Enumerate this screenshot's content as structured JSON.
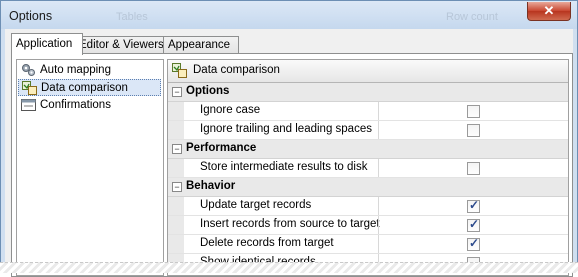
{
  "window": {
    "title": "Options",
    "close_glyph": "✕",
    "ghost_left": "Tables",
    "ghost_right": "Row count"
  },
  "tabs": [
    {
      "label": "Application",
      "active": true
    },
    {
      "label": "Editor & Viewers",
      "active": false
    },
    {
      "label": "Appearance",
      "active": false
    }
  ],
  "sidebar": {
    "items": [
      {
        "label": "Auto mapping",
        "icon": "auto-mapping-icon",
        "selected": false
      },
      {
        "label": "Data comparison",
        "icon": "data-comparison-icon",
        "selected": true
      },
      {
        "label": "Confirmations",
        "icon": "confirmations-icon",
        "selected": false
      }
    ]
  },
  "panel": {
    "header": "Data comparison",
    "categories": [
      {
        "name": "Options",
        "items": [
          {
            "label": "Ignore case",
            "checked": false
          },
          {
            "label": "Ignore trailing and leading spaces",
            "checked": false
          }
        ]
      },
      {
        "name": "Performance",
        "items": [
          {
            "label": "Store intermediate results to disk",
            "checked": false
          }
        ]
      },
      {
        "name": "Behavior",
        "items": [
          {
            "label": "Update target records",
            "checked": true
          },
          {
            "label": "Insert records from source to target",
            "checked": true
          },
          {
            "label": "Delete records from target",
            "checked": true
          },
          {
            "label": "Show identical records",
            "checked": false
          }
        ]
      }
    ],
    "collapse_glyph": "−"
  },
  "colors": {
    "title_bg": "#c5d8ee",
    "selection": "#dbe7f7",
    "check": "#2c4a8c"
  }
}
